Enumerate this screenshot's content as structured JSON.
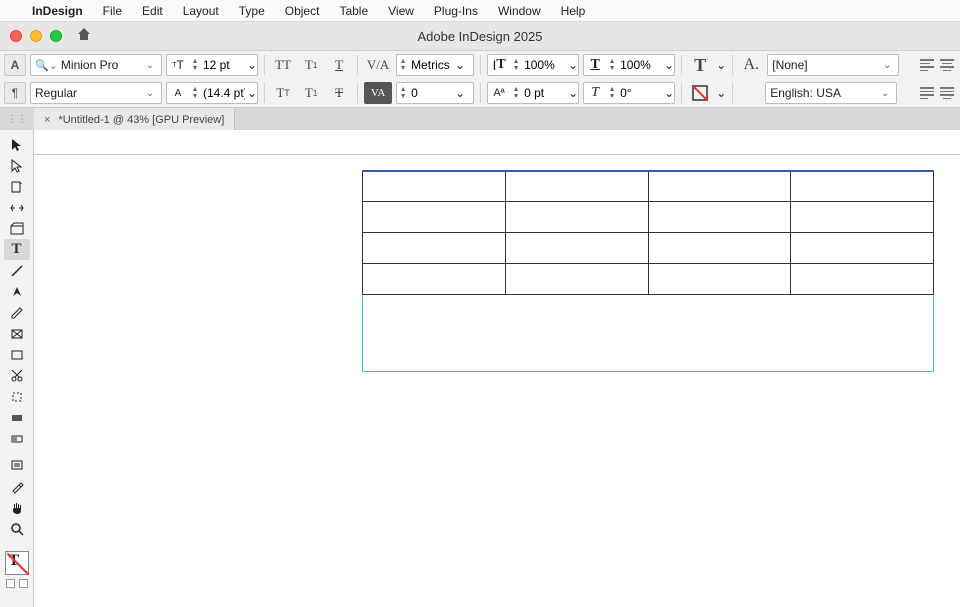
{
  "menubar": {
    "apple": "",
    "app": "InDesign",
    "items": [
      "File",
      "Edit",
      "Layout",
      "Type",
      "Object",
      "Table",
      "View",
      "Plug-Ins",
      "Window",
      "Help"
    ]
  },
  "titlebar": {
    "title": "Adobe InDesign 2025"
  },
  "control": {
    "font": "Minion Pro",
    "style": "Regular",
    "size": "12 pt",
    "leading": "(14.4 pt)",
    "kerning": "Metrics",
    "tracking": "0",
    "vscale": "100%",
    "hscale": "100%",
    "baseline": "0 pt",
    "skew": "0°",
    "char_style": "[None]",
    "language": "English: USA"
  },
  "tab": {
    "label": "*Untitled-1 @ 43% [GPU Preview]"
  },
  "table": {
    "rows": 4,
    "cols": 4
  }
}
